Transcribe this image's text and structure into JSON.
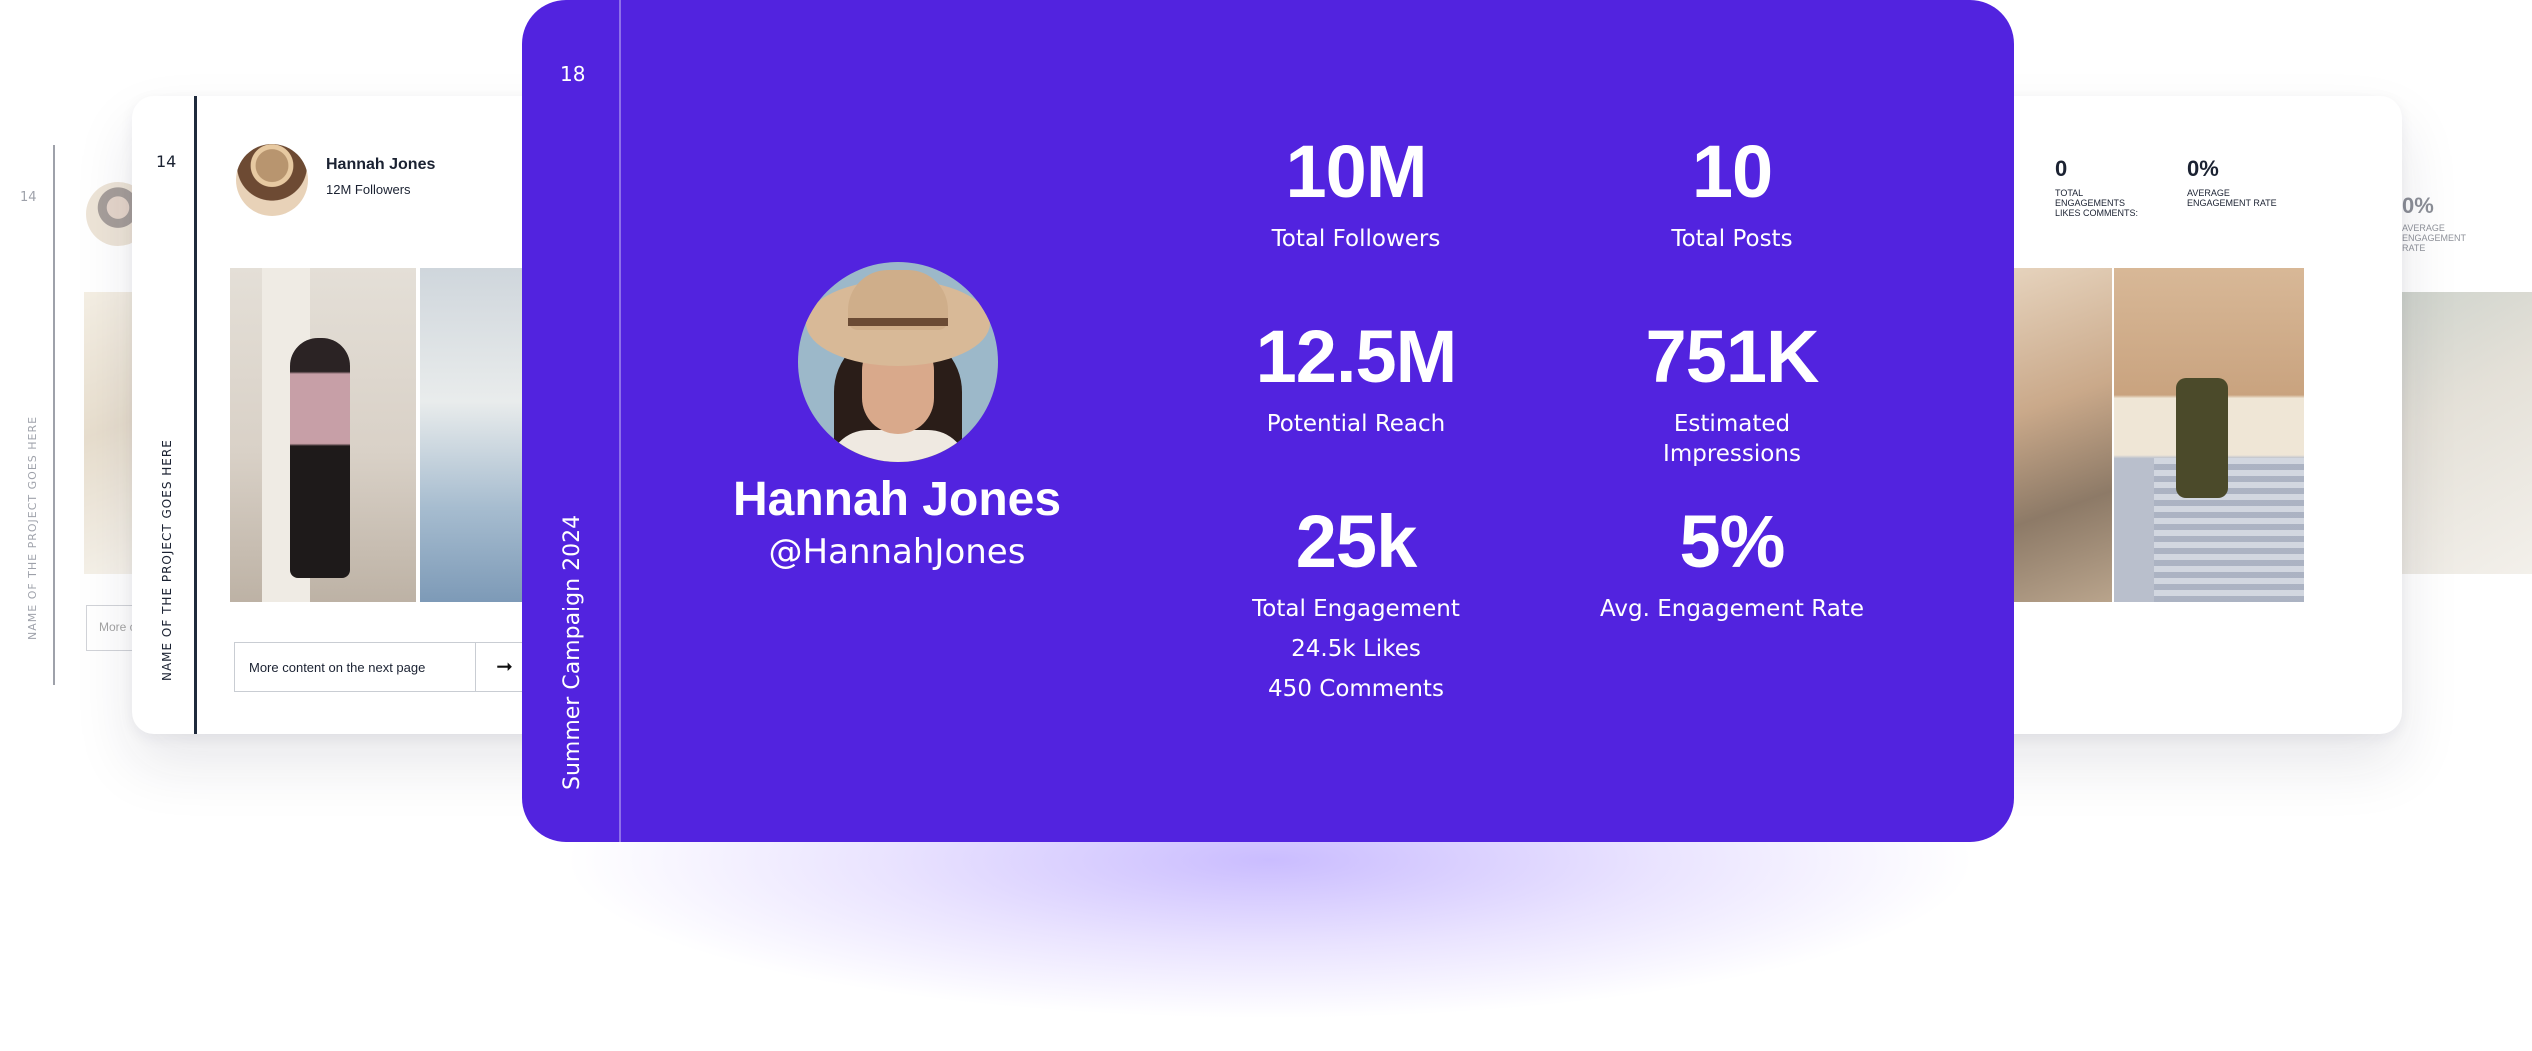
{
  "back_left": {
    "page_number": "14",
    "project_name": "NAME OF THE PROJECT GOES HERE",
    "more_button": "More c"
  },
  "back_right": {
    "avg_engagement_value": "0%",
    "avg_engagement_label": "AVERAGE ENGAGEMENT RATE"
  },
  "mid_slide": {
    "page_number": "14",
    "project_name": "NAME OF THE PROJECT GOES HERE",
    "profile_name": "Hannah Jones",
    "followers": "12M Followers",
    "more_content": "More content on the next page",
    "arrow": "➞",
    "stats": [
      {
        "value": "0",
        "label": "TOTAL ENGAGEMENTS LIKES COMMENTS:"
      },
      {
        "value": "0%",
        "label": "AVERAGE ENGAGEMENT RATE"
      }
    ]
  },
  "front_slide": {
    "page_number": "18",
    "campaign": "Summer Campaign 2024",
    "profile": {
      "name": "Hannah Jones",
      "handle": "@HannahJones"
    },
    "stats": {
      "total_followers": {
        "value": "10M",
        "label": "Total Followers"
      },
      "total_posts": {
        "value": "10",
        "label": "Total Posts"
      },
      "potential_reach": {
        "value": "12.5M",
        "label": "Potential Reach"
      },
      "estimated_impressions": {
        "value": "751K",
        "label": "Estimated Impressions"
      },
      "total_engagement": {
        "value": "25k",
        "label": "Total Engagement",
        "likes": "24.5k Likes",
        "comments": "450 Comments"
      },
      "avg_engagement_rate": {
        "value": "5%",
        "label": "Avg. Engagement Rate"
      }
    }
  },
  "colors": {
    "front_background": "#5223df",
    "text_dark": "#1b2232",
    "glow": "#6a3cff"
  }
}
